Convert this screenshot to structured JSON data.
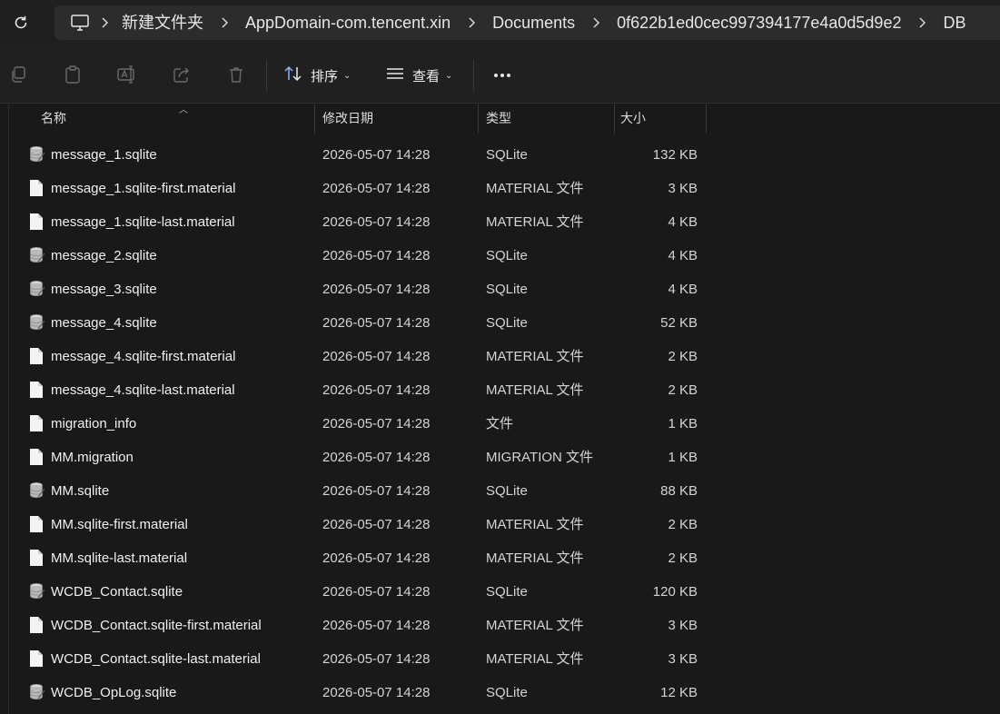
{
  "breadcrumb": {
    "items": [
      "新建文件夹",
      "AppDomain-com.tencent.xin",
      "Documents",
      "0f622b1ed0cec997394177e4a0d5d9e2",
      "DB"
    ]
  },
  "toolbar": {
    "sort_label": "排序",
    "view_label": "查看"
  },
  "columns": {
    "name": "名称",
    "date": "修改日期",
    "type": "类型",
    "size": "大小"
  },
  "files": [
    {
      "name": "message_1.sqlite",
      "date": "2026-05-07 14:28",
      "type": "SQLite",
      "size": "132 KB",
      "icon": "database-file-icon"
    },
    {
      "name": "message_1.sqlite-first.material",
      "date": "2026-05-07 14:28",
      "type": "MATERIAL 文件",
      "size": "3 KB",
      "icon": "document-file-icon"
    },
    {
      "name": "message_1.sqlite-last.material",
      "date": "2026-05-07 14:28",
      "type": "MATERIAL 文件",
      "size": "4 KB",
      "icon": "document-file-icon"
    },
    {
      "name": "message_2.sqlite",
      "date": "2026-05-07 14:28",
      "type": "SQLite",
      "size": "4 KB",
      "icon": "database-file-icon"
    },
    {
      "name": "message_3.sqlite",
      "date": "2026-05-07 14:28",
      "type": "SQLite",
      "size": "4 KB",
      "icon": "database-file-icon"
    },
    {
      "name": "message_4.sqlite",
      "date": "2026-05-07 14:28",
      "type": "SQLite",
      "size": "52 KB",
      "icon": "database-file-icon"
    },
    {
      "name": "message_4.sqlite-first.material",
      "date": "2026-05-07 14:28",
      "type": "MATERIAL 文件",
      "size": "2 KB",
      "icon": "document-file-icon"
    },
    {
      "name": "message_4.sqlite-last.material",
      "date": "2026-05-07 14:28",
      "type": "MATERIAL 文件",
      "size": "2 KB",
      "icon": "document-file-icon"
    },
    {
      "name": "migration_info",
      "date": "2026-05-07 14:28",
      "type": "文件",
      "size": "1 KB",
      "icon": "document-file-icon"
    },
    {
      "name": "MM.migration",
      "date": "2026-05-07 14:28",
      "type": "MIGRATION 文件",
      "size": "1 KB",
      "icon": "document-file-icon"
    },
    {
      "name": "MM.sqlite",
      "date": "2026-05-07 14:28",
      "type": "SQLite",
      "size": "88 KB",
      "icon": "database-file-icon"
    },
    {
      "name": "MM.sqlite-first.material",
      "date": "2026-05-07 14:28",
      "type": "MATERIAL 文件",
      "size": "2 KB",
      "icon": "document-file-icon"
    },
    {
      "name": "MM.sqlite-last.material",
      "date": "2026-05-07 14:28",
      "type": "MATERIAL 文件",
      "size": "2 KB",
      "icon": "document-file-icon"
    },
    {
      "name": "WCDB_Contact.sqlite",
      "date": "2026-05-07 14:28",
      "type": "SQLite",
      "size": "120 KB",
      "icon": "database-file-icon"
    },
    {
      "name": "WCDB_Contact.sqlite-first.material",
      "date": "2026-05-07 14:28",
      "type": "MATERIAL 文件",
      "size": "3 KB",
      "icon": "document-file-icon"
    },
    {
      "name": "WCDB_Contact.sqlite-last.material",
      "date": "2026-05-07 14:28",
      "type": "MATERIAL 文件",
      "size": "3 KB",
      "icon": "document-file-icon"
    },
    {
      "name": "WCDB_OpLog.sqlite",
      "date": "2026-05-07 14:28",
      "type": "SQLite",
      "size": "12 KB",
      "icon": "database-file-icon"
    }
  ]
}
